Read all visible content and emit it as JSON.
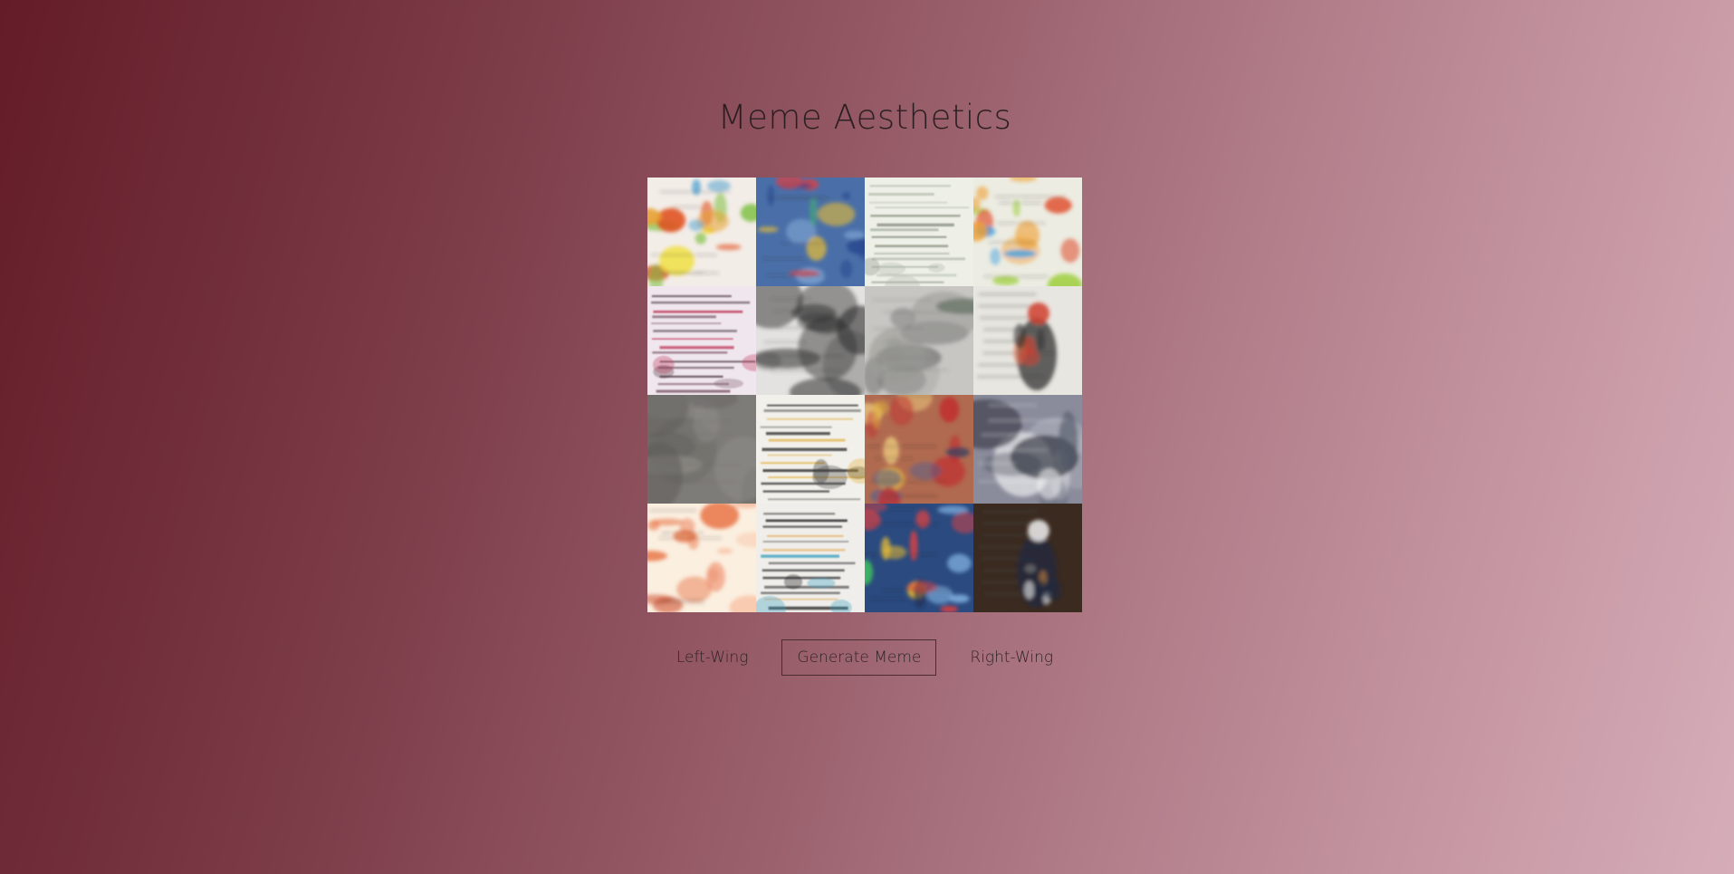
{
  "page": {
    "title": "Meme Aesthetics"
  },
  "controls": {
    "left_label": "Left-Wing",
    "generate_label": "Generate Meme",
    "right_label": "Right-Wing"
  },
  "grid": {
    "rows": 4,
    "cols": 4,
    "tiles": [
      {
        "name": "meme-tile-1",
        "base": "#f3ede8",
        "palette": [
          "#e8a030",
          "#e05020",
          "#7cc040",
          "#4aa0d0",
          "#f0e040"
        ],
        "style": "splash"
      },
      {
        "name": "meme-tile-2",
        "base": "#4a6fa8",
        "palette": [
          "#2a4a90",
          "#e04040",
          "#40c060",
          "#f0c030",
          "#7aa0d0"
        ],
        "style": "splash"
      },
      {
        "name": "meme-tile-3",
        "base": "#eef0e8",
        "palette": [
          "#8a9080",
          "#b0b8a8",
          "#70786a"
        ],
        "style": "lines"
      },
      {
        "name": "meme-tile-4",
        "base": "#ecece2",
        "palette": [
          "#f0a030",
          "#e05030",
          "#a0d040",
          "#40a0e0"
        ],
        "style": "splash"
      },
      {
        "name": "meme-tile-5",
        "base": "#f0e6ee",
        "palette": [
          "#503a44",
          "#c04060",
          "#806070"
        ],
        "style": "lines"
      },
      {
        "name": "meme-tile-6",
        "base": "#e4e2e0",
        "palette": [
          "#404040",
          "#707070",
          "#2a2a2a"
        ],
        "style": "fade"
      },
      {
        "name": "meme-tile-7",
        "base": "#c8c6c2",
        "palette": [
          "#707070",
          "#4a5a4a",
          "#9a9a96"
        ],
        "style": "fade"
      },
      {
        "name": "meme-tile-8",
        "base": "#e8e6e0",
        "palette": [
          "#d04030",
          "#303030",
          "#a06040",
          "#e07050"
        ],
        "style": "figure"
      },
      {
        "name": "meme-tile-9",
        "base": "#7e7c78",
        "palette": [
          "#6a6864",
          "#908e8a",
          "#5a5854"
        ],
        "style": "fade"
      },
      {
        "name": "meme-tile-10",
        "base": "#f2f0ea",
        "palette": [
          "#2a2a2a",
          "#4a4a4a",
          "#e0b040"
        ],
        "style": "lines"
      },
      {
        "name": "meme-tile-11",
        "base": "#b06a50",
        "palette": [
          "#e0b040",
          "#c03030",
          "#506090",
          "#f0d080",
          "#304060"
        ],
        "style": "splash"
      },
      {
        "name": "meme-tile-12",
        "base": "#8a8c9c",
        "palette": [
          "#f8f8f8",
          "#505868",
          "#303440",
          "#c0c4cc"
        ],
        "style": "fade"
      },
      {
        "name": "meme-tile-13",
        "base": "#fbefe0",
        "palette": [
          "#e87040",
          "#f0a080",
          "#d05030",
          "#f8c0a0"
        ],
        "style": "splash"
      },
      {
        "name": "meme-tile-14",
        "base": "#f0eeea",
        "palette": [
          "#202020",
          "#505050",
          "#40a0c0",
          "#e0a040"
        ],
        "style": "lines"
      },
      {
        "name": "meme-tile-15",
        "base": "#2a4a80",
        "palette": [
          "#e04040",
          "#40c060",
          "#f0c030",
          "#80b0e0",
          "#1a2a50"
        ],
        "style": "splash"
      },
      {
        "name": "meme-tile-16",
        "base": "#3a2a20",
        "palette": [
          "#f0f0f0",
          "#202a40",
          "#c08040",
          "#808080"
        ],
        "style": "figure"
      }
    ]
  }
}
